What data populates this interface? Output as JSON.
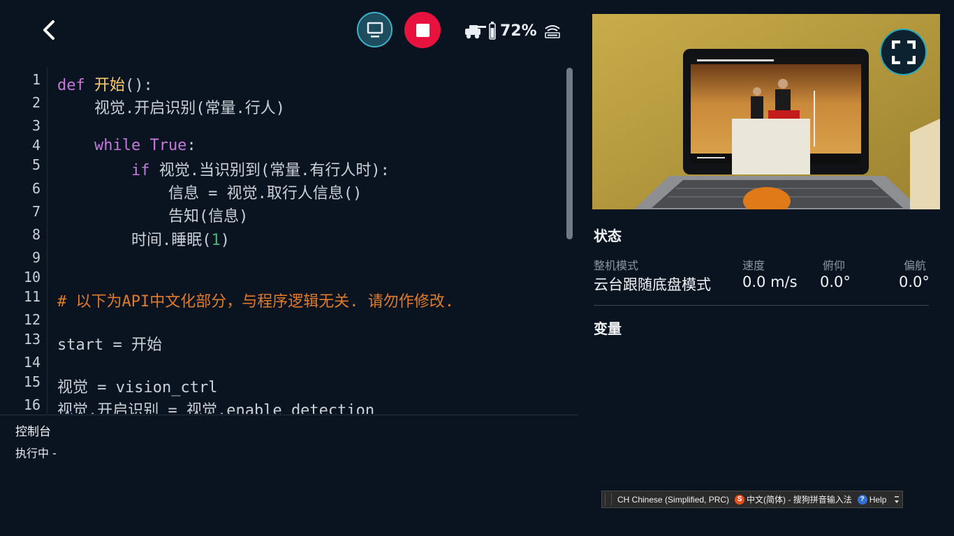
{
  "editor": {
    "line_numbers": [
      "1",
      "2",
      "3",
      "4",
      "5",
      "6",
      "7",
      "8",
      "9",
      "10",
      "11",
      "12",
      "13",
      "14",
      "15",
      "16"
    ],
    "lines": [
      {
        "a": "def ",
        "b": "开始",
        "c": "():"
      },
      {
        "text": "    视觉.开启识别(常量.行人)"
      },
      {
        "text": ""
      },
      {
        "kw": "    while True",
        "rest": ":"
      },
      {
        "kw": "        if",
        "rest": " 视觉.当识别到(常量.有行人时):"
      },
      {
        "text": "            信息 = 视觉.取行人信息()"
      },
      {
        "text": "            告知(信息)"
      },
      {
        "pre": "        时间.睡眠(",
        "num": "1",
        "post": ")"
      },
      {
        "text": ""
      },
      {
        "text": ""
      },
      {
        "comment": "# 以下为API中文化部分，与程序逻辑无关. 请勿作修改."
      },
      {
        "text": ""
      },
      {
        "text": "start = 开始"
      },
      {
        "text": ""
      },
      {
        "text": "视觉 = vision_ctrl"
      },
      {
        "text": "视觉.开启识别 = 视觉.enable_detection"
      }
    ]
  },
  "topbar": {
    "battery": "72%",
    "icons": [
      "back-icon",
      "screen-icon",
      "stop-icon",
      "robot-icon",
      "battery-icon",
      "wifi-icon"
    ]
  },
  "console": {
    "title": "控制台",
    "line": "执行中 -"
  },
  "status": {
    "title": "状态",
    "mode_label": "整机模式",
    "mode_value": "云台跟随底盘模式",
    "speed_label": "速度",
    "speed_value": "0.0 m/s",
    "pitch_label": "俯仰",
    "pitch_value": "0.0°",
    "yaw_label": "偏航",
    "yaw_value": "0.0°"
  },
  "variables": {
    "title": "变量"
  },
  "ime": {
    "language": "CH Chinese (Simplified, PRC)",
    "input_method": "中文(简体) - 搜狗拼音输入法",
    "help": "Help",
    "sogou_glyph": "S",
    "help_glyph": "?"
  },
  "colors": {
    "background": "#0a1420",
    "stop": "#e8123f",
    "accent": "#3fb3c6",
    "keyword": "#c678dd",
    "function": "#ffcb6b",
    "comment": "#e07b2a"
  }
}
